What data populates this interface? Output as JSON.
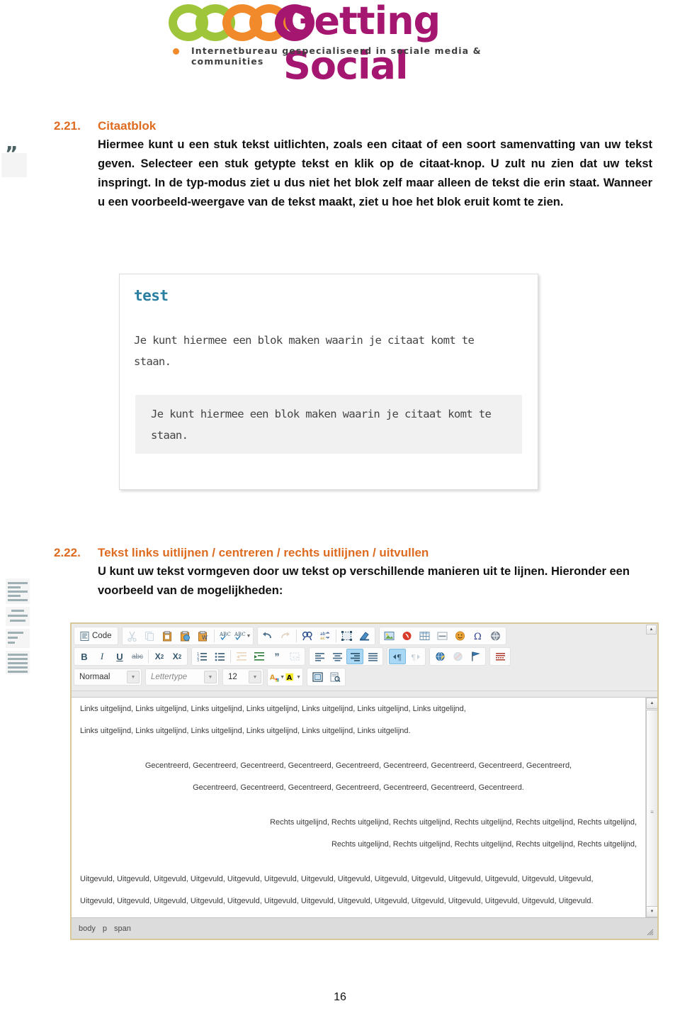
{
  "header": {
    "logo_text": "Getting Social",
    "tagline": "Internetbureau gespecialiseerd in sociale media & communities",
    "colors": {
      "green": "#9fc63a",
      "orange": "#f18a2b",
      "magenta": "#a4166f"
    }
  },
  "margin": {
    "quote_icon": "quote-marks-icon",
    "align_icon": "text-alignment-icon"
  },
  "sections": [
    {
      "number": "2.21.",
      "title": "Citaatblok",
      "body": "Hiermee kunt u een stuk tekst uitlichten, zoals een citaat of een soort samenvatting van uw tekst geven. Selecteer een stuk getypte tekst en  klik op de citaat-knop. U zult nu zien dat uw tekst inspringt. In de typ-modus ziet u dus niet het blok zelf maar alleen de tekst die erin staat. Wanneer u een voorbeeld-weergave van de tekst maakt, ziet u hoe het blok eruit komt te zien."
    },
    {
      "number": "2.22.",
      "title": "Tekst links uitlijnen / centreren / rechts uitlijnen / uitvullen",
      "body": "U kunt uw tekst vormgeven door uw tekst op verschillende manieren uit te lijnen. Hieronder een voorbeeld van de mogelijkheden:"
    }
  ],
  "quote_screenshot": {
    "title": "test",
    "paragraph": "Je kunt hiermee een blok maken waarin je citaat komt te staan.",
    "blockquote": "Je kunt hiermee een blok maken waarin je citaat komt te staan."
  },
  "editor": {
    "toolbar_row1": [
      {
        "name": "source-code-button",
        "label": "Code"
      },
      {
        "name": "cut-button",
        "label": ""
      },
      {
        "name": "copy-button",
        "label": ""
      },
      {
        "name": "paste-button",
        "label": ""
      },
      {
        "name": "paste-as-plain-text-button",
        "label": ""
      },
      {
        "name": "paste-from-word-button",
        "label": ""
      },
      {
        "name": "spell-check-button",
        "label": ""
      },
      {
        "name": "spell-check-as-you-type-button",
        "label": ""
      },
      {
        "name": "undo-button",
        "label": ""
      },
      {
        "name": "redo-button",
        "label": ""
      },
      {
        "name": "find-button",
        "label": ""
      },
      {
        "name": "replace-button",
        "label": ""
      },
      {
        "name": "select-all-button",
        "label": ""
      },
      {
        "name": "remove-format-button",
        "label": ""
      },
      {
        "name": "image-button",
        "label": ""
      },
      {
        "name": "flash-button",
        "label": ""
      },
      {
        "name": "table-button",
        "label": ""
      },
      {
        "name": "horizontal-rule-button",
        "label": ""
      },
      {
        "name": "smiley-button",
        "label": ""
      },
      {
        "name": "special-character-button",
        "label": ""
      },
      {
        "name": "page-break-button",
        "label": ""
      }
    ],
    "toolbar_row2": [
      {
        "name": "bold-button",
        "label": "B"
      },
      {
        "name": "italic-button",
        "label": "I"
      },
      {
        "name": "underline-button",
        "label": "U"
      },
      {
        "name": "strikethrough-button",
        "label": "abc"
      },
      {
        "name": "subscript-button",
        "label": "X"
      },
      {
        "name": "superscript-button",
        "label": "X"
      },
      {
        "name": "numbered-list-button",
        "label": ""
      },
      {
        "name": "bulleted-list-button",
        "label": ""
      },
      {
        "name": "decrease-indent-button",
        "label": ""
      },
      {
        "name": "increase-indent-button",
        "label": ""
      },
      {
        "name": "blockquote-button",
        "label": ""
      },
      {
        "name": "create-div-button",
        "label": ""
      },
      {
        "name": "align-left-button",
        "label": ""
      },
      {
        "name": "align-center-button",
        "label": ""
      },
      {
        "name": "align-right-button",
        "label": ""
      },
      {
        "name": "justify-button",
        "label": ""
      },
      {
        "name": "text-direction-ltr-button",
        "label": ""
      },
      {
        "name": "text-direction-rtl-button",
        "label": ""
      },
      {
        "name": "link-button",
        "label": ""
      },
      {
        "name": "unlink-button",
        "label": ""
      },
      {
        "name": "anchor-button",
        "label": ""
      },
      {
        "name": "show-blocks-button",
        "label": ""
      }
    ],
    "toolbar_row3": {
      "format_select": "Normaal",
      "font_select_placeholder": "Lettertype",
      "size_select": "12",
      "text_color_button": "A",
      "background_color_button": "A",
      "maximize_button": "maximize-icon",
      "preview_button": "preview-icon"
    },
    "content": [
      {
        "align": "left",
        "text": "Links uitgelijnd, Links uitgelijnd, Links uitgelijnd, Links uitgelijnd, Links uitgelijnd, Links uitgelijnd, Links uitgelijnd,"
      },
      {
        "align": "left",
        "text": "Links uitgelijnd, Links uitgelijnd, Links uitgelijnd, Links uitgelijnd, Links uitgelijnd, Links uitgelijnd."
      },
      {
        "align": "center",
        "text": "Gecentreerd, Gecentreerd, Gecentreerd, Gecentreerd, Gecentreerd, Gecentreerd, Gecentreerd, Gecentreerd, Gecentreerd,"
      },
      {
        "align": "center",
        "text": "Gecentreerd, Gecentreerd, Gecentreerd, Gecentreerd, Gecentreerd, Gecentreerd, Gecentreerd."
      },
      {
        "align": "right",
        "text": "Rechts uitgelijnd, Rechts uitgelijnd, Rechts uitgelijnd, Rechts uitgelijnd, Rechts uitgelijnd, Rechts uitgelijnd,"
      },
      {
        "align": "right",
        "text": "Rechts uitgelijnd, Rechts uitgelijnd, Rechts uitgelijnd, Rechts uitgelijnd, Rechts uitgelijnd,"
      },
      {
        "align": "justify",
        "text": "Uitgevuld, Uitgevuld, Uitgevuld, Uitgevuld, Uitgevuld, Uitgevuld, Uitgevuld, Uitgevuld, Uitgevuld, Uitgevuld, Uitgevuld, Uitgevuld, Uitgevuld, Uitgevuld,"
      },
      {
        "align": "justify",
        "text": "Uitgevuld, Uitgevuld, Uitgevuld, Uitgevuld, Uitgevuld, Uitgevuld, Uitgevuld, Uitgevuld, Uitgevuld, Uitgevuld, Uitgevuld, Uitgevuld, Uitgevuld, Uitgevuld."
      }
    ],
    "status_path": [
      "body",
      "p",
      "span"
    ],
    "border_color": "#d9c89a"
  },
  "footer": {
    "page_number": "16"
  }
}
